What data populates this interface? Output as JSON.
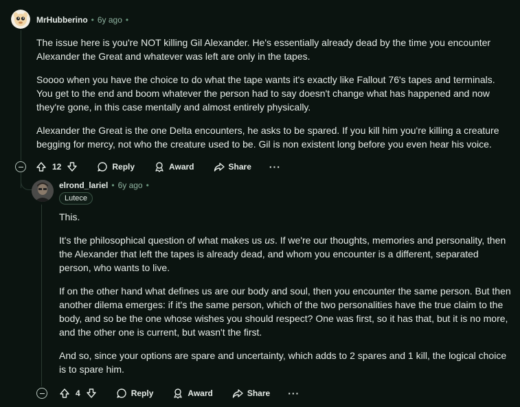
{
  "comments": [
    {
      "author": "MrHubberino",
      "time": "6y ago",
      "paragraphs": [
        "The issue here is you're NOT killing Gil Alexander. He's essentially already dead by the time you encounter Alexander the Great and whatever was left are only in the tapes.",
        "Soooo when you have the choice to do what the tape wants it's exactly like Fallout 76's tapes and terminals. You get to the end and boom whatever the person had to say doesn't change what has happened and now they're gone, in this case mentally and almost entirely physically.",
        "Alexander the Great is the one Delta encounters, he asks to be spared. If you kill him you're killing a creature begging for mercy, not who the creature used to be. Gil is non existent long before you even hear his voice."
      ],
      "votes": "12",
      "actions": {
        "reply": "Reply",
        "award": "Award",
        "share": "Share",
        "more": "···"
      }
    },
    {
      "author": "elrond_lariel",
      "time": "6y ago",
      "flair": "Lutece",
      "paragraphs": [
        "This.",
        "",
        "If on the other hand what defines us are our body and soul, then you encounter the same person. But then another dilema emerges: if it's the same person, which of the two personalities have the true claim to the body, and so be the one whose wishes you should respect? One was first, so it has that, but it is no more, and the other one is current, but wasn't the first.",
        "And so, since your options are spare and uncertainty, which adds to 2 spares and 1 kill, the logical choice is to spare him."
      ],
      "p2_before": "It's the philosophical question of what makes us ",
      "p2_emph": "us",
      "p2_after": ". If we're our thoughts, memories and personality, then the Alexander that left the tapes is already dead, and whom you encounter is a different, separated person, who wants to live.",
      "votes": "4",
      "actions": {
        "reply": "Reply",
        "award": "Award",
        "share": "Share",
        "more": "···"
      }
    }
  ],
  "colors": {
    "background": "#0b1410",
    "text": "#e6ece8",
    "meta": "#8fb3a0",
    "thread_line": "#2a3a32"
  }
}
